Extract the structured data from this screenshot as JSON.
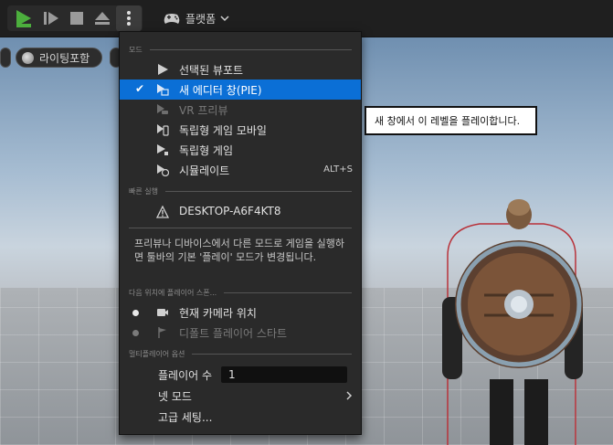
{
  "toolbar": {
    "platform_label": "플랫폼"
  },
  "viewport": {
    "lighting_label": "라이팅포함"
  },
  "menu": {
    "section_mode": "모드",
    "mode_items": [
      {
        "label": "선택된 뷰포트",
        "selected": false,
        "disabled": false
      },
      {
        "label": "새 에디터 창(PIE)",
        "selected": true,
        "disabled": false
      },
      {
        "label": "VR 프리뷰",
        "selected": false,
        "disabled": true
      },
      {
        "label": "독립형 게임 모바일",
        "selected": false,
        "disabled": false
      },
      {
        "label": "독립형 게임",
        "selected": false,
        "disabled": false
      },
      {
        "label": "시뮬레이트",
        "selected": false,
        "disabled": false,
        "shortcut": "ALT+S"
      }
    ],
    "section_quick": "빠른 실행",
    "device_label": "DESKTOP-A6F4KT8",
    "description": "프리뷰나 디바이스에서 다른 모드로 게임을 실행하면 툴바의 기본 '플레이' 모드가 변경됩니다.",
    "section_spawn": "다음 위치에 플레이어 스폰...",
    "spawn_items": [
      {
        "label": "현재 카메라 위치",
        "active": true
      },
      {
        "label": "디폴트 플레이어 스타트",
        "active": false
      }
    ],
    "section_multi": "멀티플레이어 옵션",
    "players_label": "플레이어 수",
    "players_value": "1",
    "net_mode_label": "넷 모드",
    "advanced_label": "고급 세팅..."
  },
  "tooltip": "새 창에서 이 레벨을 플레이합니다.",
  "colors": {
    "play_green": "#4caf3d",
    "selection_blue": "#0b6fd6"
  },
  "icons": [
    "play-icon",
    "frame-advance-icon",
    "stop-icon",
    "eject-icon",
    "more-icon",
    "gamepad-icon",
    "chevron-down-icon",
    "check-icon",
    "warning-icon",
    "camera-icon",
    "chevron-right-icon"
  ]
}
